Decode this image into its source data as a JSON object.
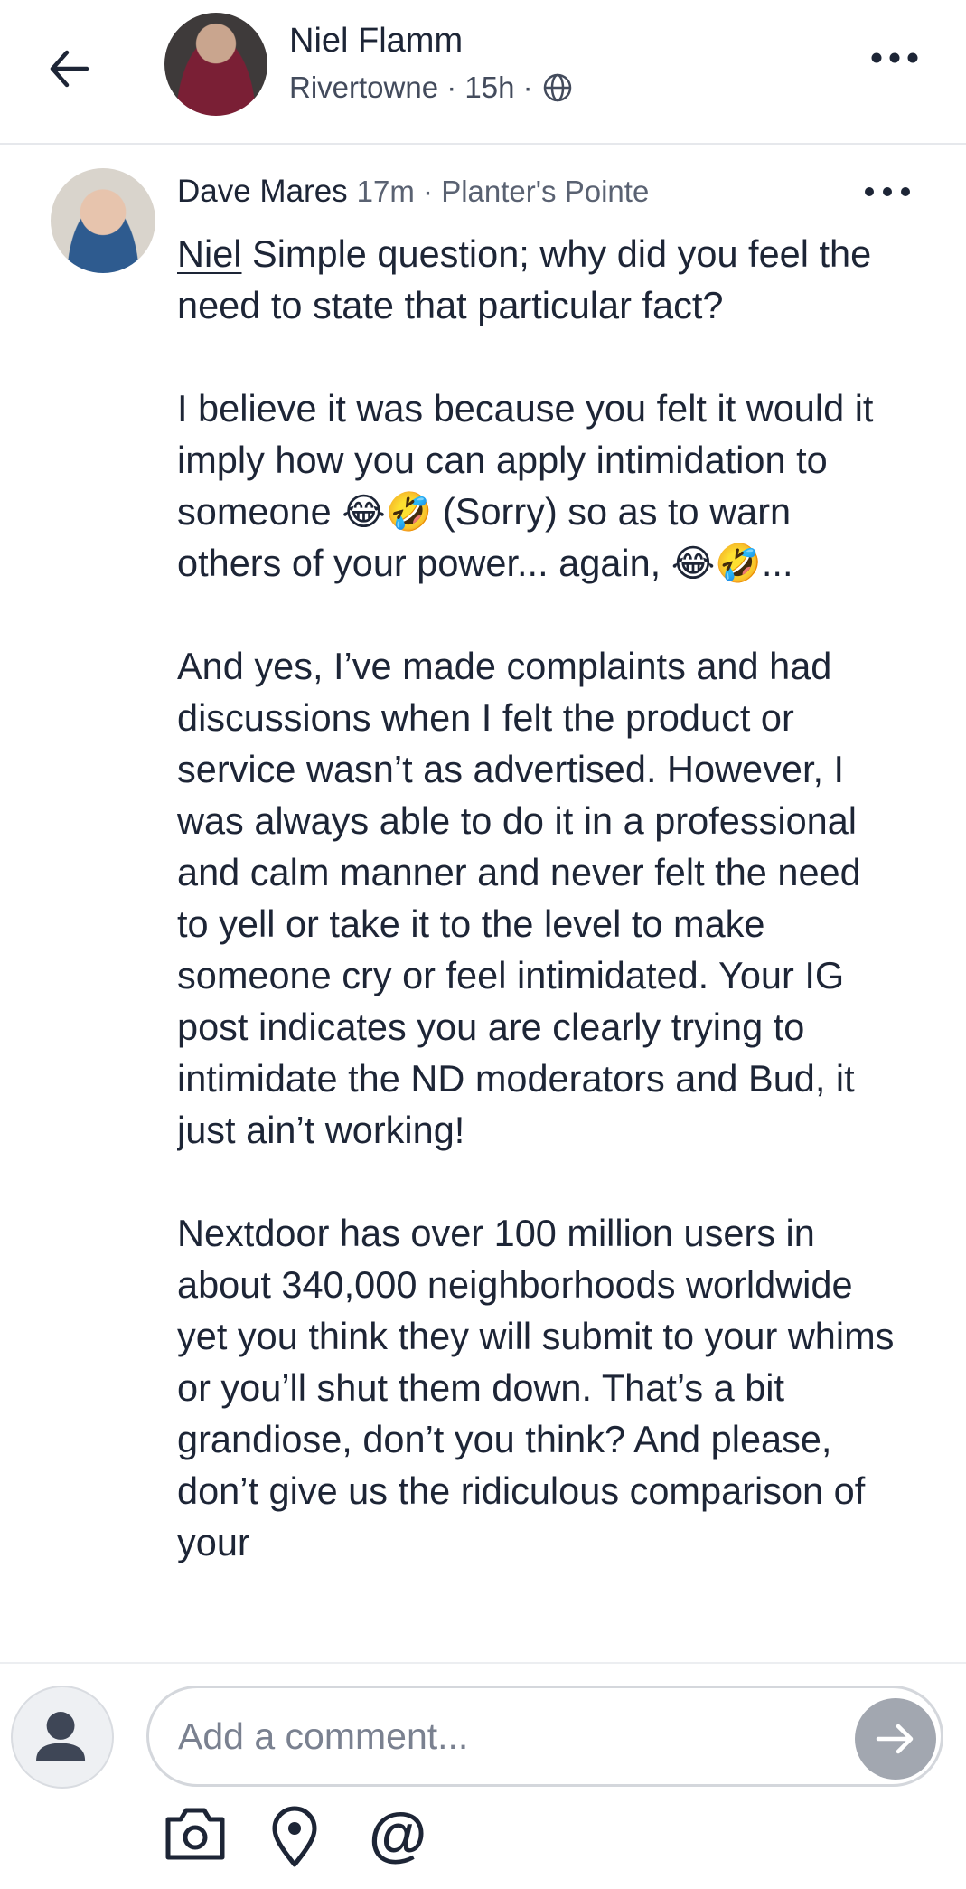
{
  "header": {
    "name": "Niel Flamm",
    "subtitle": "Rivertowne · 15h ·"
  },
  "comment": {
    "author": "Dave Mares",
    "meta": "17m · Planter's Pointe",
    "mention": "Niel",
    "first_line_rest": " Simple question; why did you feel the need to state that particular fact?",
    "paragraph_2a": "I believe it was because you felt it would it imply how you can apply intimidation to someone ",
    "paragraph_2b": " (Sorry) so as to warn others of your power... again, ",
    "paragraph_2c": "...",
    "emoji": "😂🤣",
    "paragraph_3": "And yes, I’ve made complaints and had discussions when I felt the product or service wasn’t as advertised. However, I was always able to do it in a professional and calm manner and never felt the need to yell or take it to the level to make someone cry or feel intimidated. Your IG post indicates you are clearly trying to intimidate the ND moderators and Bud, it just ain’t working!",
    "paragraph_4": "Nextdoor has over 100 million users in about 340,000 neighborhoods worldwide yet you think they will submit to your whims or you’ll shut them down. That’s a bit grandiose, don’t you think? And please, don’t give us the ridiculous comparison of your"
  },
  "composer": {
    "placeholder": "Add a comment...",
    "mention_symbol": "@"
  },
  "icons": [
    "back-arrow-icon",
    "globe-icon",
    "more-horizontal-icon",
    "user-icon",
    "send-arrow-icon",
    "camera-icon",
    "location-pin-icon",
    "at-sign-icon"
  ]
}
